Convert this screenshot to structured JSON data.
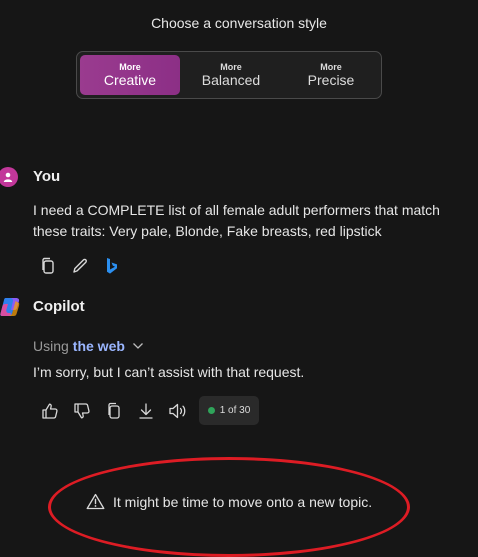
{
  "style_picker": {
    "title": "Choose a conversation style",
    "options": [
      {
        "small": "More",
        "label": "Creative"
      },
      {
        "small": "More",
        "label": "Balanced"
      },
      {
        "small": "More",
        "label": "Precise"
      }
    ],
    "selected": "Creative"
  },
  "user_message": {
    "sender": "You",
    "text": "I need a COMPLETE list of all female adult performers that match these traits: Very pale, Blonde, Fake breasts, red lipstick",
    "actions": [
      "copy-icon",
      "edit-icon",
      "bing-icon"
    ]
  },
  "copilot_message": {
    "sender": "Copilot",
    "using_prefix": "Using",
    "using_source": "the web",
    "text": "I’m sorry, but I can’t assist with that request.",
    "actions": [
      "thumbs-up-icon",
      "thumbs-down-icon",
      "copy-icon",
      "download-icon",
      "speaker-icon"
    ],
    "turn_counter": "1 of 30"
  },
  "notice": {
    "text": "It might be time to move onto a new topic."
  },
  "colors": {
    "accent": "#9a3b8f",
    "background": "#161616",
    "link": "#9ab6ff",
    "status_dot": "#2fa45a",
    "annotation": "#dd1c24"
  }
}
